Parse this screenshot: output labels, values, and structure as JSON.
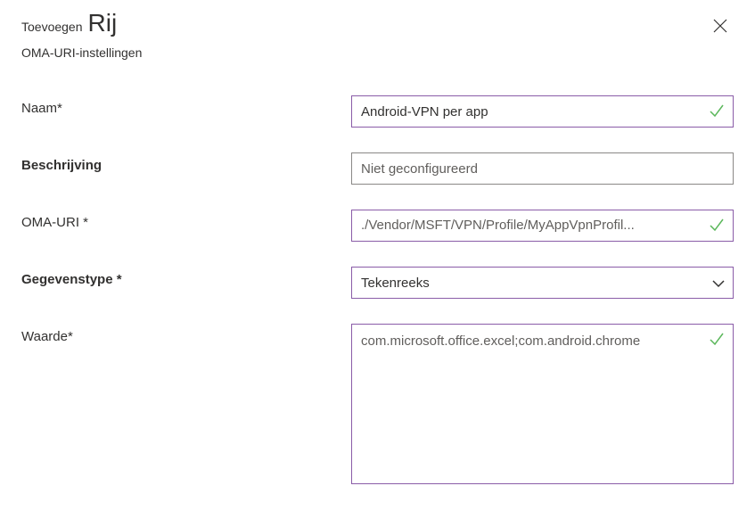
{
  "header": {
    "pre_title": "Toevoegen",
    "title": "Rij",
    "subtitle": "OMA-URI-instellingen"
  },
  "fields": {
    "name": {
      "label": "Naam*",
      "value": "Android-VPN per app"
    },
    "description": {
      "label": "Beschrijving",
      "placeholder": "Niet geconfigureerd",
      "value": ""
    },
    "oma_uri": {
      "label": "OMA-URI *",
      "value": "./Vendor/MSFT/VPN/Profile/MyAppVpnProfil..."
    },
    "data_type": {
      "label": "Gegevenstype *",
      "value": "Tekenreeks"
    },
    "value": {
      "label": "Waarde*",
      "value": "com.microsoft.office.excel;com.android.chrome"
    }
  }
}
